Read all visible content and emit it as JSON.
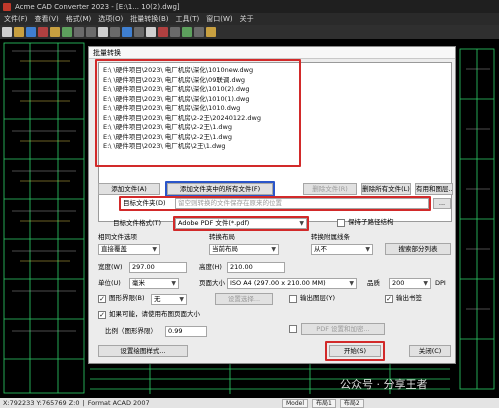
{
  "app": {
    "title": "Acme CAD Converter 2023 - [E:\\1...                10(2).dwg]",
    "menu": [
      "文件(F)",
      "查看(V)",
      "格式(M)",
      "选项(O)",
      "批量转换(B)",
      "工具(T)",
      "窗口(W)",
      "关于"
    ]
  },
  "dialog": {
    "title": "批量转换",
    "files": [
      "E:\\      \\硬件项目\\2023\\      电厂机房\\深化\\1010new.dwg",
      "E:\\      \\硬件项目\\2023\\      电厂机房\\深化\\09联调.dwg",
      "E:\\      \\硬件项目\\2023\\      电厂机房\\深化\\1010(2).dwg",
      "E:\\      \\硬件项目\\2023\\      电厂机房\\深化\\1010(1).dwg",
      "E:\\      \\硬件项目\\2023\\      电厂机房\\深化\\1010.dwg",
      "E:\\      \\硬件项目\\2023\\      电厂机房\\2-2王\\20240122.dwg",
      "E:\\      \\硬件项目\\2023\\      电厂机房\\2-2王\\1.dwg",
      "E:\\      \\硬件项目\\2023\\      电厂机房\\2-2王\\1.dwg",
      "E:\\      \\硬件项目\\2023\\      电厂机房\\2王\\1.dwg"
    ],
    "buttons": {
      "add_file": "添加文件(A)",
      "add_folder_files": "添加文件夹中的所有文件(F)",
      "remove_file": "删除文件(R)",
      "remove_all": "删除所有文件(L)",
      "drawings": "有用和图层...",
      "browse": "...",
      "layout_list": "搜索部分列表",
      "settings": "设置选择...",
      "pdf_settings": "PDF 设置和加密...",
      "print_style": "设置绘图样式...",
      "start": "开始(S)",
      "close": "关闭(C)"
    },
    "target_folder": {
      "label": "目标文件夹(D)",
      "placeholder": "留空则转换的文件保存在原来的位置"
    },
    "target_format": {
      "label": "目标文件格式(T)",
      "value": "Adobe PDF 文件(*.pdf)"
    },
    "keep_subfolder_label": "保持子路径结构",
    "groups": {
      "relative_label": "相同文件选项",
      "relative_value": "直接覆盖",
      "layout_label": "转换布局",
      "layout_value": "当前布局",
      "linetype_label": "转换附属线条",
      "linetype_value": "从不"
    },
    "size": {
      "width_label": "宽度(W)",
      "width_value": "297.00",
      "height_label": "高度(H)",
      "height_value": "210.00",
      "unit_label": "单位(U)",
      "unit_value": "毫米",
      "page_size_label": "页面大小",
      "page_size_value": "ISO A4 (297.00 x 210.00 MM)",
      "quality_label": "品质",
      "quality_value": "200",
      "dpi_label": "DPI"
    },
    "options": {
      "border_label": "图形界限(B)",
      "border_checked": true,
      "border_select": "无",
      "auto_size_label": "如果可能，请使用布图页面大小",
      "auto_size_checked": true,
      "scale_label": "比例（图形界限）",
      "scale_value": "0.99",
      "output_layer_label": "输出图层(Y)",
      "output_layer_checked": false,
      "output_bookmark_label": "输出书签",
      "output_bookmark_checked": true,
      "pdf_encrypt_checked": false
    }
  },
  "status": {
    "coords": "X:792233  Y:765769  Z:0",
    "format": "Format ACAD 2007",
    "tabs": [
      "Model",
      "布局1",
      "布局2"
    ]
  },
  "watermark": "公众号 · 分享王者",
  "colors": {
    "highlight_red": "#d22a2a",
    "highlight_blue": "#2b56c9",
    "cad_line": "#2fd16a"
  }
}
